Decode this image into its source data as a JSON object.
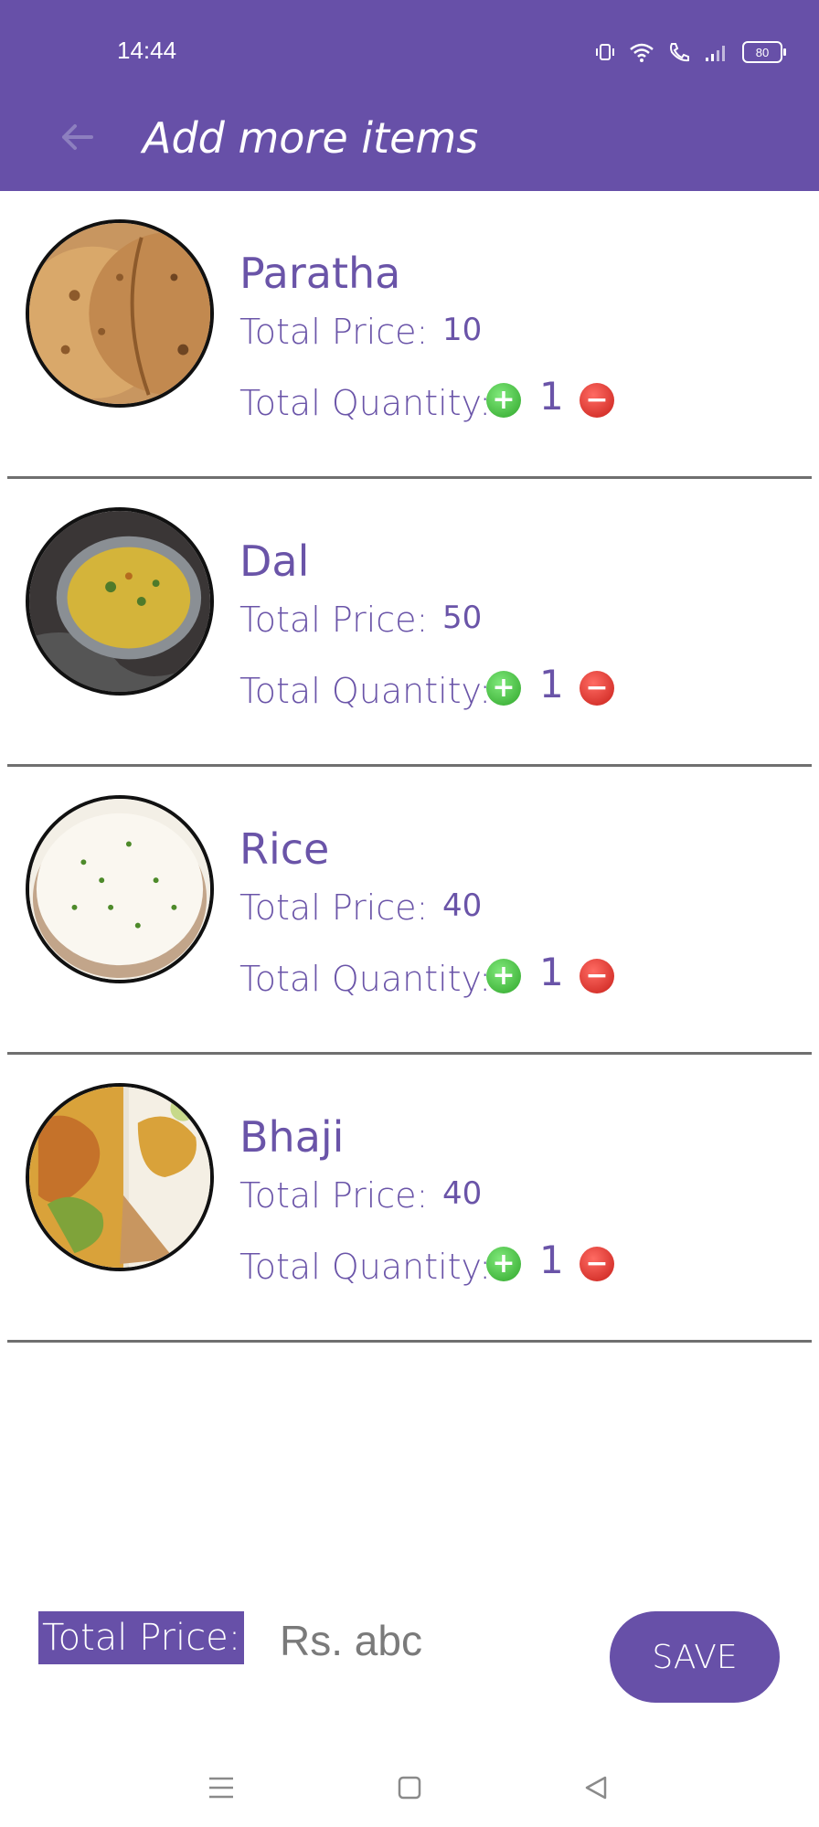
{
  "status_bar": {
    "time": "14:44",
    "battery": "80"
  },
  "header": {
    "title": "Add more items",
    "back_icon": "arrow-left-icon"
  },
  "items": [
    {
      "name": "Paratha",
      "price_label": "Total Price:",
      "price": "10",
      "qty_label": "Total Quantity:",
      "quantity": "1"
    },
    {
      "name": "Dal",
      "price_label": "Total Price:",
      "price": "50",
      "qty_label": "Total Quantity:",
      "quantity": "1"
    },
    {
      "name": "Rice",
      "price_label": "Total Price:",
      "price": "40",
      "qty_label": "Total Quantity:",
      "quantity": "1"
    },
    {
      "name": "Bhaji",
      "price_label": "Total Price:",
      "price": "40",
      "qty_label": "Total Quantity:",
      "quantity": "1"
    }
  ],
  "footer": {
    "total_label": "Total Price:",
    "total_value": "Rs. abc",
    "save_label": "SAVE"
  },
  "nav": {
    "menu_icon": "menu-icon",
    "home_icon": "home-icon",
    "back_icon": "back-triangle-icon"
  },
  "colors": {
    "primary": "#6750a8",
    "text": "#6a54a8",
    "plus": "#2fa62a",
    "minus": "#c8201a"
  }
}
